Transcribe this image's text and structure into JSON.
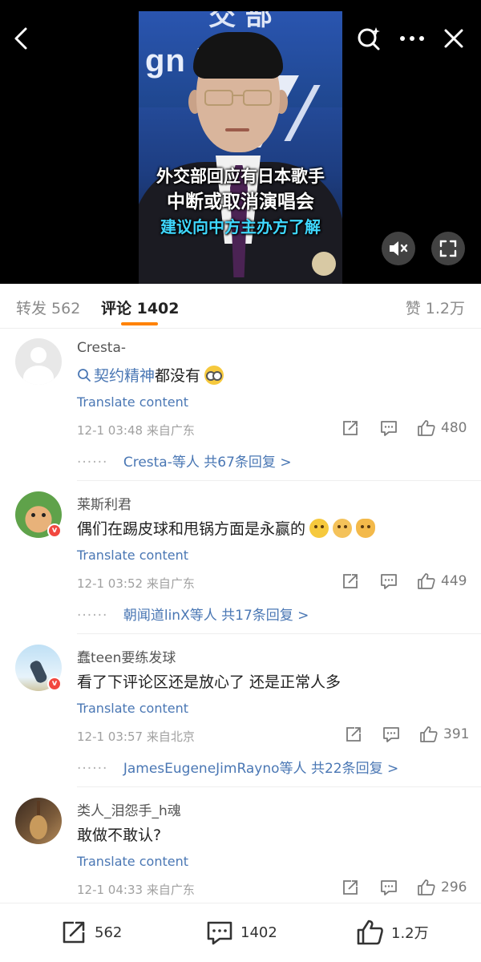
{
  "video": {
    "wall_text": "gn irs",
    "wall_top_text": "交 部",
    "caption_line1": "外交部回应有日本歌手",
    "caption_line2": "中断或取消演唱会",
    "caption_line3": "建议向中方主办方了解",
    "caption_highlight_color": "#3fd8ff",
    "icons": [
      "chevron-left-icon",
      "search-sparkle-icon",
      "more-icon",
      "close-icon",
      "mute-icon",
      "fullscreen-icon"
    ]
  },
  "tabs": {
    "repost": "转发 562",
    "comments": "评论 1402",
    "likes": "赞 1.2万",
    "active": "comments",
    "accent_color": "#ff8200"
  },
  "comments": [
    {
      "username": "Cresta-",
      "topic": "契约精神",
      "text": "都没有",
      "emojis": [
        "glasses-emoji"
      ],
      "translate": "Translate content",
      "time": "12-1 03:48",
      "location": "来自广东",
      "likes": "480",
      "thread_dots": "······",
      "thread_users": "Cresta-等人",
      "thread_count": "共67条回复 >"
    },
    {
      "username": "莱斯利君",
      "text": "偶们在踢皮球和甩锅方面是永赢的",
      "emojis": [
        "smile-emoji",
        "shy-emoji",
        "doge-emoji"
      ],
      "badge": "v",
      "translate": "Translate content",
      "time": "12-1 03:52",
      "location": "来自广东",
      "likes": "449",
      "thread_dots": "······",
      "thread_users": "朝闻道linX等人",
      "thread_count": "共17条回复 >"
    },
    {
      "username": "蠢teen要练发球",
      "text": "看了下评论区还是放心了 还是正常人多",
      "badge": "v",
      "translate": "Translate content",
      "time": "12-1 03:57",
      "location": "来自北京",
      "likes": "391",
      "thread_dots": "······",
      "thread_users": "JamesEugeneJimRayno等人",
      "thread_count": "共22条回复 >"
    },
    {
      "username": "类人_泪怨手_h魂",
      "text": "敢做不敢认?",
      "translate": "Translate content",
      "time": "12-1 04:33",
      "location": "来自广东",
      "likes": "296"
    }
  ],
  "bottom_bar": {
    "repost_count": "562",
    "comment_count": "1402",
    "like_count": "1.2万"
  },
  "colors": {
    "link": "#4a77b4",
    "meta": "#a0a0a0",
    "badge": "#f2473f"
  }
}
